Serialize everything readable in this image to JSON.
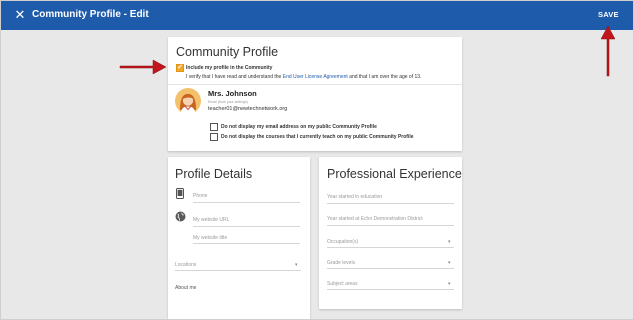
{
  "topbar": {
    "close_icon": "close-icon",
    "title": "Community Profile - Edit",
    "save_label": "SAVE"
  },
  "community_card": {
    "title": "Community Profile",
    "include_label": "Include my profile in the Community",
    "include_checked": true,
    "verify_text_before": "I verify that I have read and understand the",
    "verify_link": "End User License Agreement",
    "verify_text_after": "and that I am over the age of 13.",
    "user_name": "Mrs. Johnson",
    "email_caption": "Email (from your settings)",
    "email": "teacher01@newtechnetwork.org",
    "option_hide_email": "Do not display my email address on my public Community Profile",
    "option_hide_courses": "Do not display the courses that I currently teach on my public Community Profile"
  },
  "profile_details": {
    "title": "Profile Details",
    "phone_placeholder": "Phone",
    "website_url_placeholder": "My website URL",
    "website_title_placeholder": "My website title",
    "locations_placeholder": "Locations",
    "about_me_label": "About me"
  },
  "professional_experience": {
    "title": "Professional Experience",
    "year_started_education": "Year started in education",
    "year_started_district": "Year started at Echo Demonstration District",
    "occupations": "Occupation(s)",
    "grade_levels": "Grade levels",
    "subject_areas": "Subject areas"
  },
  "colors": {
    "topbar": "#1f5bab",
    "checkbox_accent": "#f5a623",
    "annotation_arrow": "#c0161b",
    "link": "#1f5bab"
  }
}
